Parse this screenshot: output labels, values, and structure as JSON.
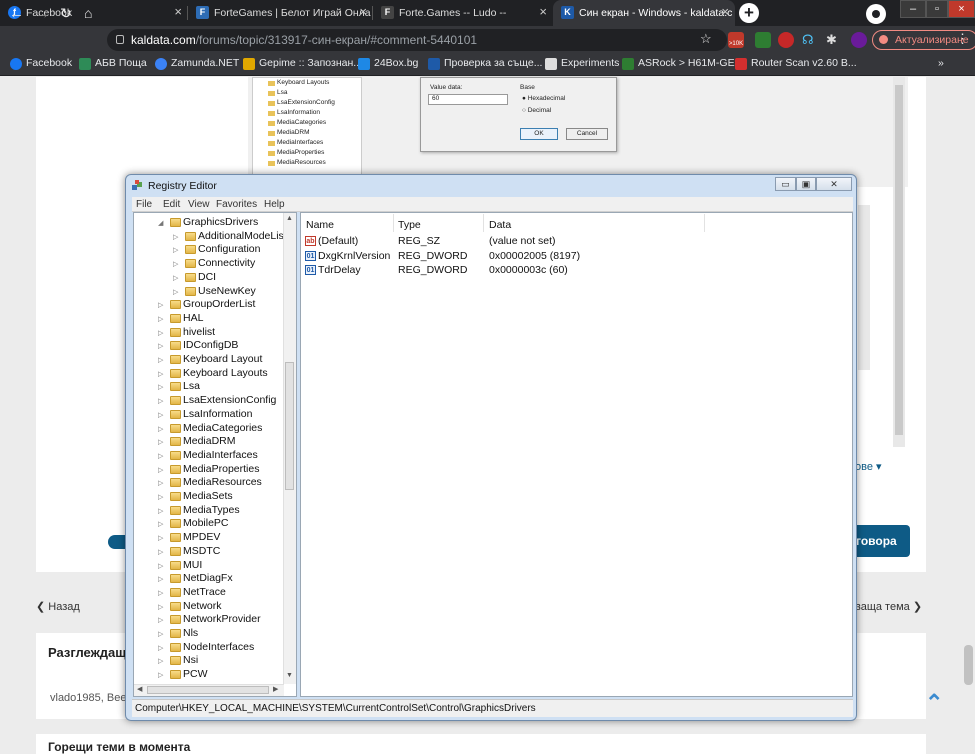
{
  "browser": {
    "tabs": [
      {
        "label": "Facebook",
        "fav_color": "#1877f2",
        "fav_glyph": "f"
      },
      {
        "label": "ForteGames | Белот Играй Онла",
        "fav_color": "#2d6cb5",
        "fav_glyph": "F"
      },
      {
        "label": "Forte.Games -- Ludo --",
        "fav_color": "#444444",
        "fav_glyph": "F"
      },
      {
        "label": "Син екран - Windows - kaldata.c",
        "fav_color": "#1e5aa8",
        "fav_glyph": "K"
      }
    ],
    "new_tab": "+",
    "url_host": "kaldata.com",
    "url_path": "/forums/topic/313917-син-екран/#comment-5440101",
    "update_label": "Актуализиране",
    "bookmarks": [
      {
        "label": "Facebook",
        "color": "#1877f2"
      },
      {
        "label": "АБВ Поща",
        "color": "#2e8b57"
      },
      {
        "label": "Zamunda.NET",
        "color": "#3b82f6"
      },
      {
        "label": "Gepime :: Запознан...",
        "color": "#e0a800"
      },
      {
        "label": "24Box.bg",
        "color": "#1e88e5"
      },
      {
        "label": "Проверка за съще...",
        "color": "#1e5aa8"
      },
      {
        "label": "Experiments",
        "color": "#dddddd"
      },
      {
        "label": "ASRock > H61M-GE",
        "color": "#2e7d32"
      },
      {
        "label": "Router Scan v2.60 B...",
        "color": "#d32f2f"
      }
    ],
    "bookmarks_more": "»",
    "badge_10k": ">10K"
  },
  "inner": {
    "tree": [
      "Keyboard Layouts",
      "Lsa",
      "LsaExtensionConfig",
      "LsaInformation",
      "MediaCategories",
      "MediaDRM",
      "MediaInterfaces",
      "MediaProperties",
      "MediaResources"
    ],
    "value_data_label": "Value data:",
    "value_data": "60",
    "base_label": "Base",
    "hex": "Hexadecimal",
    "dec": "Decimal",
    "ok": "OK",
    "cancel": "Cancel"
  },
  "page": {
    "more": "ове ▾",
    "reply": "говора",
    "back": "Назад",
    "next": "ваща тема",
    "browsing": "Разглеждащ",
    "user": "vlado1985, Bee",
    "hot": "Горещи теми в момента"
  },
  "regedit": {
    "title": "Registry Editor",
    "menu": [
      "File",
      "Edit",
      "View",
      "Favorites",
      "Help"
    ],
    "tree": [
      {
        "label": "GraphicsDrivers",
        "level": 0,
        "expanded": true
      },
      {
        "label": "AdditionalModeLists",
        "level": 1
      },
      {
        "label": "Configuration",
        "level": 1
      },
      {
        "label": "Connectivity",
        "level": 1
      },
      {
        "label": "DCI",
        "level": 1
      },
      {
        "label": "UseNewKey",
        "level": 1
      },
      {
        "label": "GroupOrderList",
        "level": 0
      },
      {
        "label": "HAL",
        "level": 0
      },
      {
        "label": "hivelist",
        "level": 0
      },
      {
        "label": "IDConfigDB",
        "level": 0
      },
      {
        "label": "Keyboard Layout",
        "level": 0
      },
      {
        "label": "Keyboard Layouts",
        "level": 0
      },
      {
        "label": "Lsa",
        "level": 0
      },
      {
        "label": "LsaExtensionConfig",
        "level": 0
      },
      {
        "label": "LsaInformation",
        "level": 0
      },
      {
        "label": "MediaCategories",
        "level": 0
      },
      {
        "label": "MediaDRM",
        "level": 0
      },
      {
        "label": "MediaInterfaces",
        "level": 0
      },
      {
        "label": "MediaProperties",
        "level": 0
      },
      {
        "label": "MediaResources",
        "level": 0
      },
      {
        "label": "MediaSets",
        "level": 0
      },
      {
        "label": "MediaTypes",
        "level": 0
      },
      {
        "label": "MobilePC",
        "level": 0
      },
      {
        "label": "MPDEV",
        "level": 0
      },
      {
        "label": "MSDTC",
        "level": 0
      },
      {
        "label": "MUI",
        "level": 0
      },
      {
        "label": "NetDiagFx",
        "level": 0
      },
      {
        "label": "NetTrace",
        "level": 0
      },
      {
        "label": "Network",
        "level": 0
      },
      {
        "label": "NetworkProvider",
        "level": 0
      },
      {
        "label": "Nls",
        "level": 0
      },
      {
        "label": "NodeInterfaces",
        "level": 0
      },
      {
        "label": "Nsi",
        "level": 0
      },
      {
        "label": "PCW",
        "level": 0
      }
    ],
    "columns": {
      "name": "Name",
      "type": "Type",
      "data": "Data"
    },
    "values": [
      {
        "name": "(Default)",
        "type": "REG_SZ",
        "data": "(value not set)",
        "icon": "string"
      },
      {
        "name": "DxgKrnlVersion",
        "type": "REG_DWORD",
        "data": "0x00002005 (8197)",
        "icon": "binary"
      },
      {
        "name": "TdrDelay",
        "type": "REG_DWORD",
        "data": "0x0000003c (60)",
        "icon": "binary"
      }
    ],
    "status": "Computer\\HKEY_LOCAL_MACHINE\\SYSTEM\\CurrentControlSet\\Control\\GraphicsDrivers"
  }
}
